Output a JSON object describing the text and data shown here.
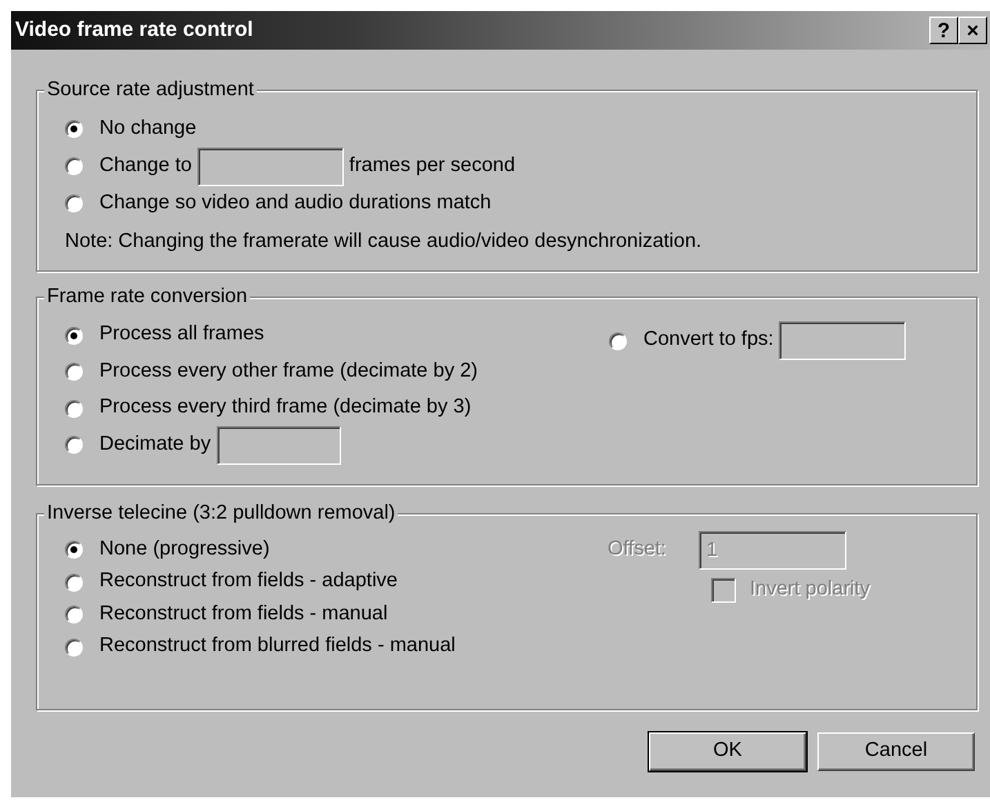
{
  "window": {
    "title": "Video frame rate control",
    "title_buttons": [
      {
        "glyph": "?"
      },
      {
        "glyph": "×"
      }
    ]
  },
  "groups": [
    {
      "title": "Source rate adjustment",
      "options": [
        {
          "kind": "radio",
          "label": "No change",
          "selected": true
        },
        {
          "kind": "radio",
          "label": "Change to",
          "selected": false,
          "field": {
            "disabled": true
          },
          "suffix": "frames per second"
        },
        {
          "kind": "radio",
          "label": "Change so video and audio durations match",
          "selected": false
        }
      ],
      "note": "Note: Changing the framerate will cause audio/video desynchronization."
    },
    {
      "title": "Frame rate conversion",
      "options": [
        {
          "kind": "radio",
          "label": "Process all frames",
          "selected": true
        },
        {
          "kind": "radio",
          "label": "Process every other frame (decimate by 2)",
          "selected": false
        },
        {
          "kind": "radio",
          "label": "Process every third frame (decimate by 3)",
          "selected": false
        },
        {
          "kind": "radio",
          "label": "Decimate by",
          "selected": false,
          "field": {
            "disabled": true
          }
        }
      ],
      "side": [
        {
          "kind": "radio",
          "label": "Convert to fps:",
          "selected": false,
          "field": {
            "disabled": true
          }
        }
      ]
    },
    {
      "title": "Inverse telecine (3:2 pulldown removal)",
      "options": [
        {
          "kind": "radio",
          "label": "None (progressive)",
          "selected": true
        },
        {
          "kind": "radio",
          "label": "Reconstruct from fields - adaptive",
          "selected": false
        },
        {
          "kind": "radio",
          "label": "Reconstruct from fields - manual",
          "selected": false
        },
        {
          "kind": "radio",
          "label": "Reconstruct from blurred fields - manual",
          "selected": false
        }
      ],
      "side": [
        {
          "kind": "labeled-field",
          "label": "Offset:",
          "value": "1",
          "disabled": true
        },
        {
          "kind": "checkbox",
          "label": "Invert polarity",
          "checked": false,
          "disabled": true
        }
      ]
    }
  ],
  "buttons": [
    {
      "label": "OK",
      "default": true
    },
    {
      "label": "Cancel",
      "default": false
    }
  ]
}
